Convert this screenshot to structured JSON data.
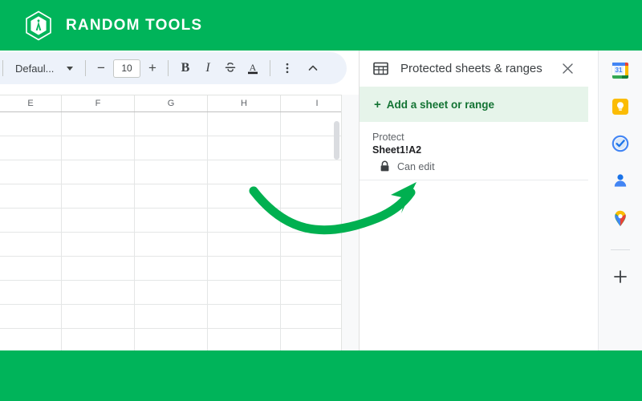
{
  "brand": {
    "name": "RANDOM TOOLS",
    "logo_icon": "hexagon-compass-logo",
    "bar_color": "#00b45a"
  },
  "toolbar": {
    "font_name": "Defaul...",
    "decrease_label": "−",
    "font_size": "10",
    "increase_label": "+",
    "bold_label": "B",
    "italic_label": "I",
    "strikethrough_icon": "strikethrough-icon",
    "text_color_label": "A",
    "more_icon": "more-vertical-icon",
    "collapse_icon": "chevron-up-icon"
  },
  "sheet": {
    "columns": [
      "E",
      "F",
      "G",
      "H",
      "I"
    ],
    "row_count": 11
  },
  "panel": {
    "icon": "sheet-grid-icon",
    "title": "Protected sheets & ranges",
    "close_icon": "close-icon",
    "add_label": "Add a sheet or range",
    "add_plus": "+",
    "items": [
      {
        "label": "Protect",
        "range": "Sheet1!A2",
        "permission": "Can edit",
        "permission_icon": "lock-icon"
      }
    ]
  },
  "rail": {
    "items": [
      {
        "name": "google-calendar",
        "label": "31"
      },
      {
        "name": "google-keep",
        "label": ""
      },
      {
        "name": "google-tasks",
        "label": ""
      },
      {
        "name": "google-contacts",
        "label": ""
      },
      {
        "name": "google-maps",
        "label": ""
      }
    ],
    "add_label": "+"
  },
  "annotation": {
    "arrow_color": "#00b050",
    "arrow_description": "curved-arrow-pointing-to-can-edit"
  }
}
